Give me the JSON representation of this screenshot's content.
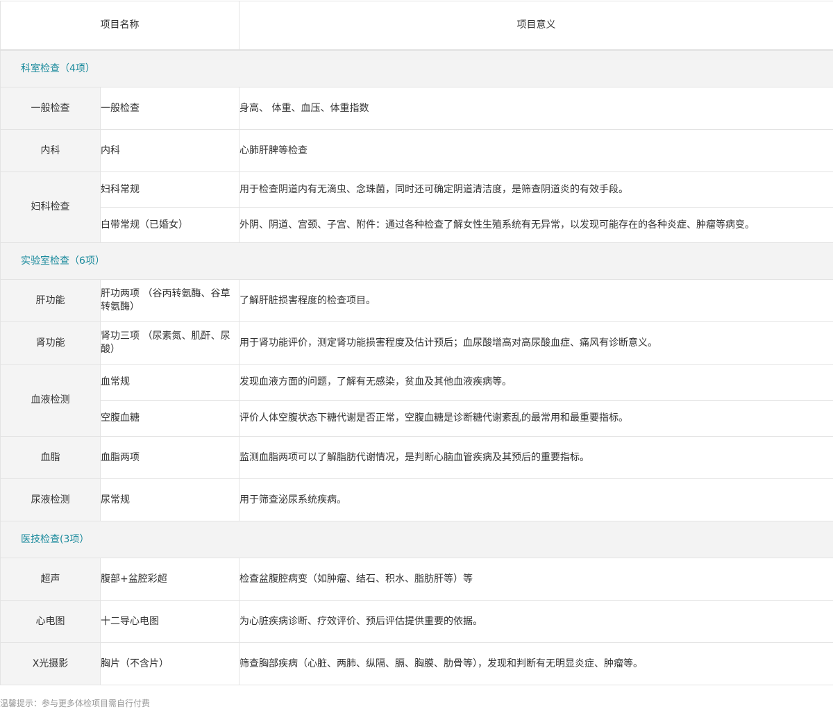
{
  "header": {
    "col_name": "项目名称",
    "col_meaning": "项目意义"
  },
  "sections": [
    {
      "title": "科室检查（4项）",
      "categories": [
        {
          "name": "一般检查",
          "items": [
            {
              "name": "一般检查",
              "meaning": "身高、 体重、血压、体重指数"
            }
          ]
        },
        {
          "name": "内科",
          "items": [
            {
              "name": "内科",
              "meaning": "心肺肝脾等检查"
            }
          ]
        },
        {
          "name": "妇科检查",
          "items": [
            {
              "name": "妇科常规",
              "meaning": "用于检查阴道内有无滴虫、念珠菌，同时还可确定阴道清洁度，是筛查阴道炎的有效手段。"
            },
            {
              "name": "白带常规（已婚女）",
              "meaning": "外阴、阴道、宫颈、子宫、附件：通过各种检查了解女性生殖系统有无异常，以发现可能存在的各种炎症、肿瘤等病变。"
            }
          ]
        }
      ]
    },
    {
      "title": "实验室检查（6项）",
      "categories": [
        {
          "name": "肝功能",
          "items": [
            {
              "name": "肝功两项 （谷丙转氨酶、谷草转氨酶）",
              "meaning": "了解肝脏损害程度的检查项目。"
            }
          ]
        },
        {
          "name": "肾功能",
          "items": [
            {
              "name": "肾功三项 （尿素氮、肌酐、尿酸）",
              "meaning": "用于肾功能评价，测定肾功能损害程度及估计预后；血尿酸增高对高尿酸血症、痛风有诊断意义。"
            }
          ]
        },
        {
          "name": "血液检测",
          "items": [
            {
              "name": "血常规",
              "meaning": "发现血液方面的问题，了解有无感染，贫血及其他血液疾病等。"
            },
            {
              "name": "空腹血糖",
              "meaning": "评价人体空腹状态下糖代谢是否正常，空腹血糖是诊断糖代谢紊乱的最常用和最重要指标。"
            }
          ]
        },
        {
          "name": "血脂",
          "items": [
            {
              "name": "血脂两项",
              "meaning": "监测血脂两项可以了解脂肪代谢情况，是判断心脑血管疾病及其预后的重要指标。"
            }
          ]
        },
        {
          "name": "尿液检测",
          "items": [
            {
              "name": "尿常规",
              "meaning": "用于筛查泌尿系统疾病。"
            }
          ]
        }
      ]
    },
    {
      "title": "医技检查(3项）",
      "categories": [
        {
          "name": "超声",
          "items": [
            {
              "name": "腹部+盆腔彩超",
              "meaning": "检查盆腹腔病变（如肿瘤、结石、积水、脂肪肝等）等"
            }
          ]
        },
        {
          "name": "心电图",
          "items": [
            {
              "name": "十二导心电图",
              "meaning": "为心脏疾病诊断、疗效评价、预后评估提供重要的依据。"
            }
          ]
        },
        {
          "name": "X光摄影",
          "items": [
            {
              "name": "胸片（不含片）",
              "meaning": "筛查胸部疾病（心脏、两肺、纵隔、膈、胸膜、肋骨等），发现和判断有无明显炎症、肿瘤等。"
            }
          ]
        }
      ]
    }
  ],
  "footer": {
    "tip": "温馨提示：参与更多体检项目需自行付费"
  }
}
